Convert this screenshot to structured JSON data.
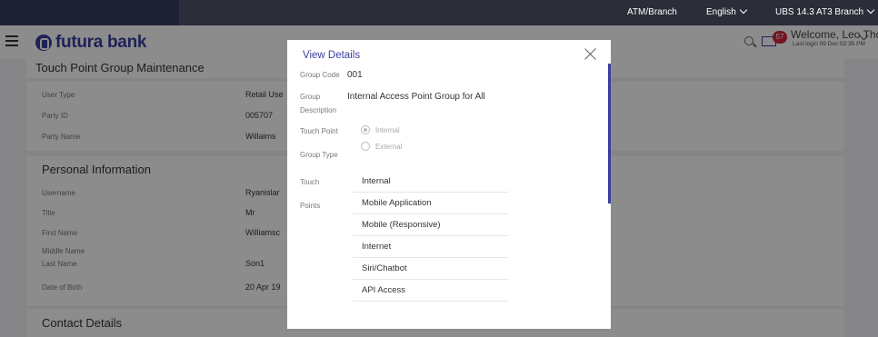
{
  "topbar": {
    "atm_branch": "ATM/Branch",
    "language": "English",
    "branch": "UBS 14.3 AT3 Branch"
  },
  "header": {
    "brand": "futura bank",
    "notification_count": "57",
    "welcome": "Welcome, Leo Thomas",
    "last_login": "Last login 09 Dec 02:35 PM"
  },
  "page": {
    "title": "Touch Point Group Maintenance",
    "party": [
      {
        "label": "User Type",
        "value": "Retail Use"
      },
      {
        "label": "Party ID",
        "value": "005707"
      },
      {
        "label": "Party Name",
        "value": "Willaims"
      }
    ],
    "personal_title": "Personal Information",
    "personal": [
      {
        "label": "Username",
        "value": "Ryanislar"
      },
      {
        "label": "Title",
        "value": "Mr"
      },
      {
        "label": "First Name",
        "value": "Williamsc"
      },
      {
        "label": "Middle Name",
        "value": ""
      },
      {
        "label": "Last Name",
        "value": "Son1"
      },
      {
        "label": "Date of Birth",
        "value": "20 Apr 19"
      }
    ],
    "contact_title": "Contact Details"
  },
  "modal": {
    "title": "View Details",
    "group_code_label": "Group Code",
    "group_code": "001",
    "group_desc_label_1": "Group",
    "group_desc_label_2": "Description",
    "group_desc": "Internal Access Point Group for All",
    "tp_group_type_label_1": "Touch Point",
    "tp_group_type_label_2": "Group Type",
    "radio_internal": "Internal",
    "radio_external": "External",
    "touch_points_label_1": "Touch",
    "touch_points_label_2": "Points",
    "touch_points": [
      "Internal",
      "Mobile Application",
      "Mobile (Responsive)",
      "Internet",
      "Siri/Chatbot",
      "API Access"
    ]
  }
}
